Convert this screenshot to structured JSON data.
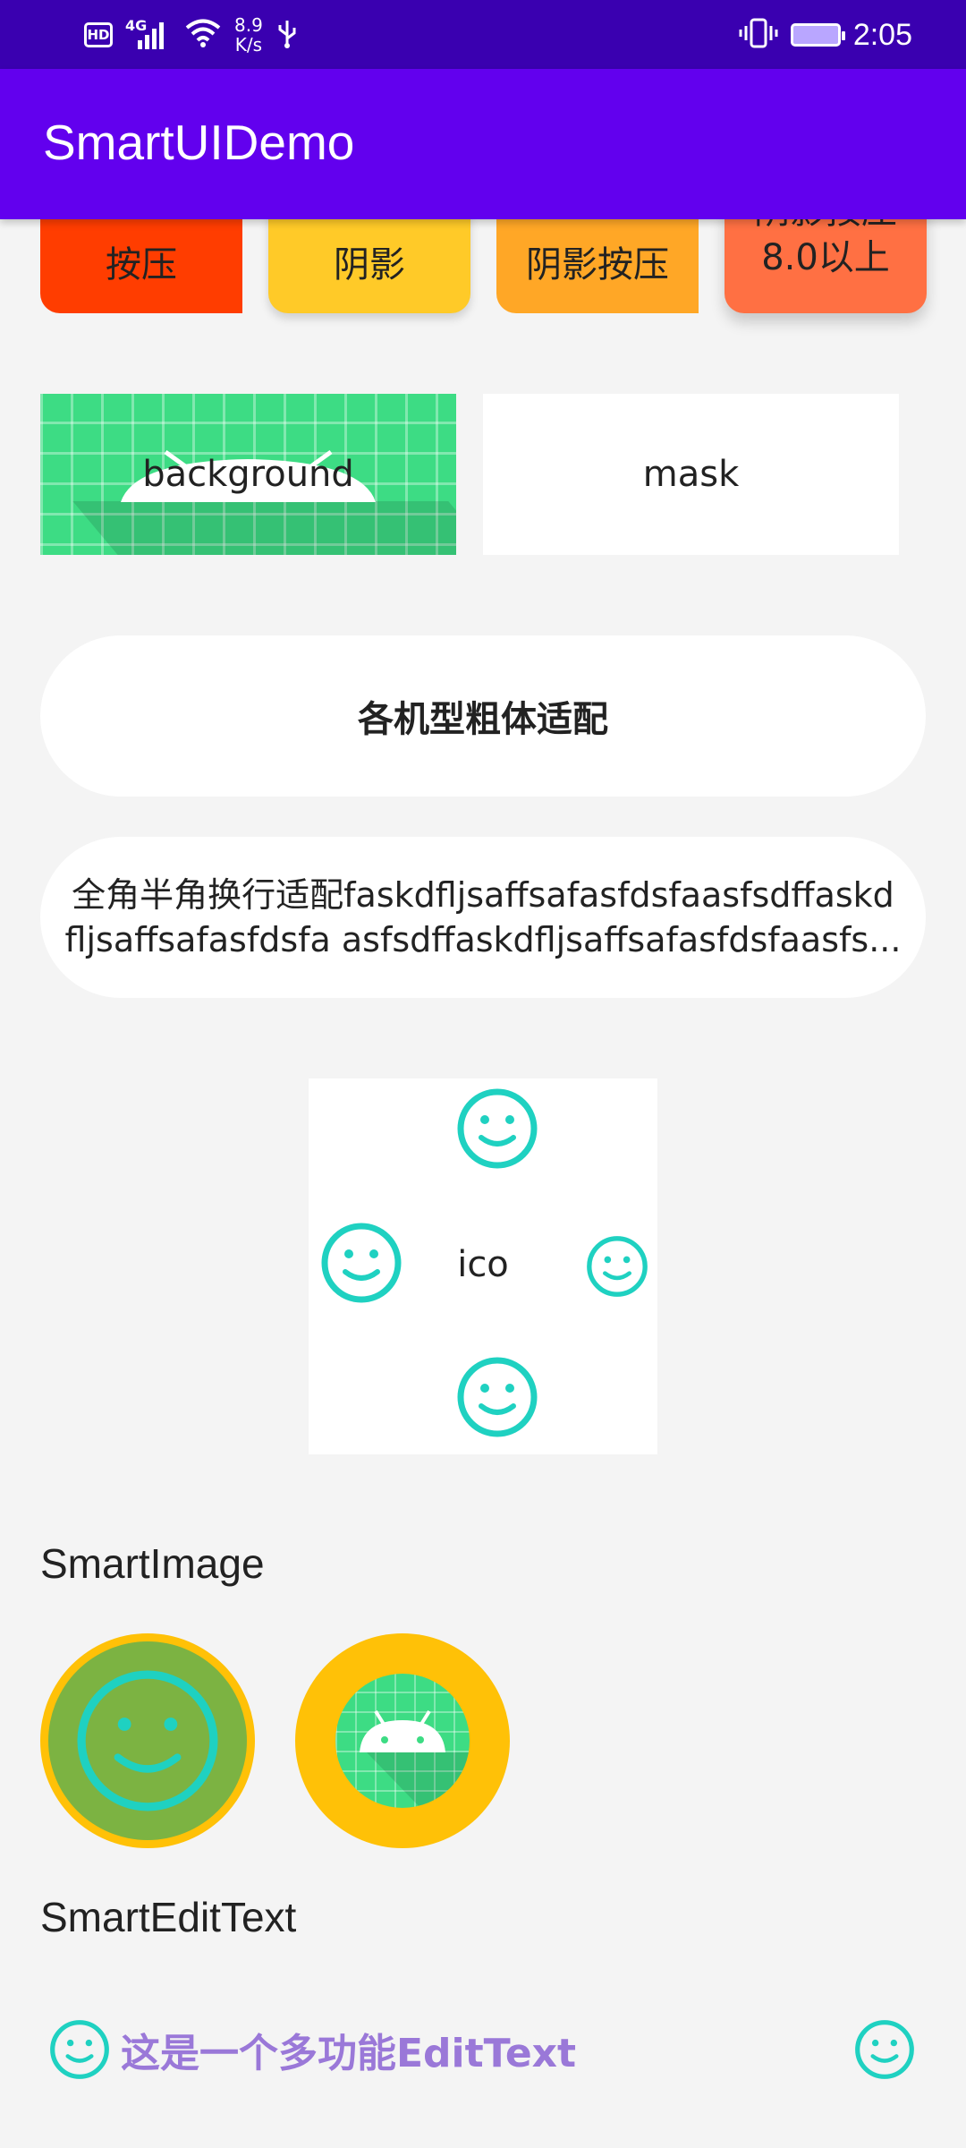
{
  "status_bar": {
    "hd": "HD",
    "network": "4G",
    "speed_value": "8.9",
    "speed_unit": "K/s",
    "time": "2:05"
  },
  "app_bar": {
    "title": "SmartUIDemo"
  },
  "buttons_row": [
    {
      "label": "按压",
      "color": "#ff3d00"
    },
    {
      "label": "阴影",
      "color": "#ffca28"
    },
    {
      "label": "阴影按压",
      "color": "#ffa726"
    },
    {
      "label_line1": "阴影按压",
      "label_line2": "8.0以上",
      "color": "#ff7043"
    }
  ],
  "background_demo": {
    "label": "background"
  },
  "mask_demo": {
    "label": "mask"
  },
  "bold_block": {
    "label": "各机型粗体适配"
  },
  "wrap_block": {
    "line1": "全角半角换行适配faskdfljsaffsafasfdsfaasfsdffaskd",
    "line2": "fljsaffsafasfdsfa asfsdffaskdfljsaffsafasfdsfaasfs..."
  },
  "ico_demo": {
    "label": "ico",
    "icons": [
      "smile-icon-top",
      "smile-icon-left",
      "smile-icon-right",
      "smile-icon-bottom"
    ]
  },
  "smart_image": {
    "title": "SmartImage"
  },
  "smart_edit_text": {
    "title": "SmartEditText",
    "value": "这是一个多功能EditText"
  },
  "colors": {
    "status_bar": "#3a00b0",
    "app_bar": "#6200ee",
    "icon_teal": "#1fd1c1",
    "edit_text": "#9a78d8"
  }
}
